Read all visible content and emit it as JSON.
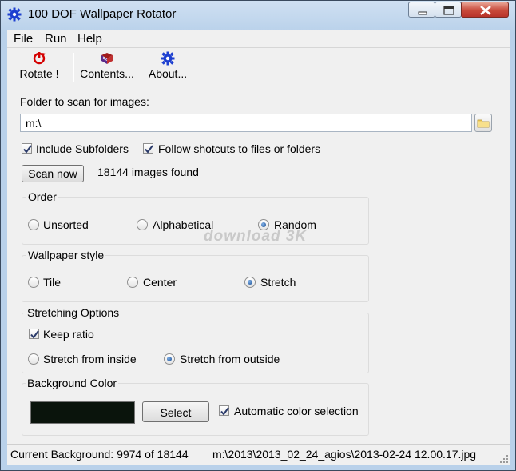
{
  "window": {
    "title": "100 DOF Wallpaper Rotator",
    "icon": "blue-gear-icon",
    "controls": {
      "minimize": "minimize-icon",
      "maximize": "maximize-icon",
      "close": "close-icon"
    }
  },
  "menu": {
    "items": [
      "File",
      "Run",
      "Help"
    ]
  },
  "toolbar": {
    "rotate": {
      "label": "Rotate !",
      "icon": "red-rotate-icon"
    },
    "contents": {
      "label": "Contents...",
      "icon": "book-icon"
    },
    "about": {
      "label": "About...",
      "icon": "blue-gear-icon"
    }
  },
  "folder": {
    "label": "Folder to scan for images:",
    "value": "m:\\",
    "browse_icon": "folder-icon"
  },
  "options": {
    "include_subfolders": {
      "label": "Include Subfolders",
      "checked": true
    },
    "follow_shortcuts": {
      "label": "Follow shotcuts to files or folders",
      "checked": true
    }
  },
  "scan": {
    "button_label": "Scan now",
    "result": "18144 images found"
  },
  "order": {
    "title": "Order",
    "options": [
      {
        "label": "Unsorted",
        "selected": false
      },
      {
        "label": "Alphabetical",
        "selected": false
      },
      {
        "label": "Random",
        "selected": true
      }
    ]
  },
  "watermark": "download 3K",
  "wallpaper_style": {
    "title": "Wallpaper style",
    "options": [
      {
        "label": "Tile",
        "selected": false
      },
      {
        "label": "Center",
        "selected": false
      },
      {
        "label": "Stretch",
        "selected": true
      }
    ]
  },
  "stretching": {
    "title": "Stretching Options",
    "keep_ratio": {
      "label": "Keep ratio",
      "checked": true
    },
    "options": [
      {
        "label": "Stretch from inside",
        "selected": false
      },
      {
        "label": "Stretch from outside",
        "selected": true
      }
    ]
  },
  "background": {
    "title": "Background Color",
    "color": "#0a140c",
    "select_label": "Select",
    "auto": {
      "label": "Automatic color selection",
      "checked": true
    }
  },
  "status": {
    "current": "Current Background: 9974 of 18144",
    "path": "m:\\2013\\2013_02_24_agios\\2013-02-24 12.00.17.jpg"
  },
  "colors": {
    "accent": "#1b4d8f",
    "window_frame": "#b9d1ea",
    "close_button": "#c8493a"
  }
}
